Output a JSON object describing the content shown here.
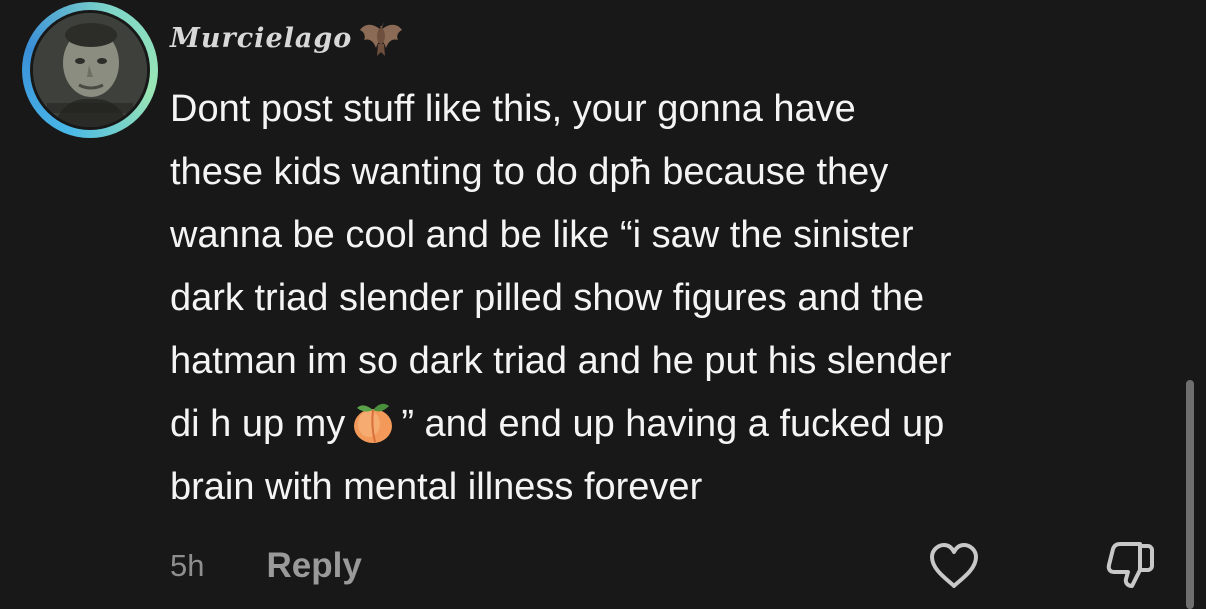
{
  "comment": {
    "username": "Murcielago",
    "username_icon": "bat-icon",
    "text_before_emoji": "Dont post stuff like this, your gonna have\nthese kids wanting to do dpħ because they\nwanna be cool and be like “i saw the sinister\ndark triad slender pilled show figures and the\nhatman im so dark triad and he put his slender\ndi h up my",
    "emoji": "peach-icon",
    "text_after_emoji": "” and end up having a fucked up\nbrain with mental illness forever",
    "timestamp": "5h",
    "reply_label": "Reply",
    "like_icon": "heart-icon",
    "dislike_icon": "thumbs-down-icon"
  },
  "colors": {
    "background": "#181818",
    "text": "#f4f4f4",
    "muted": "#8e8e8e",
    "avatar_ring": "#49b8e8"
  }
}
